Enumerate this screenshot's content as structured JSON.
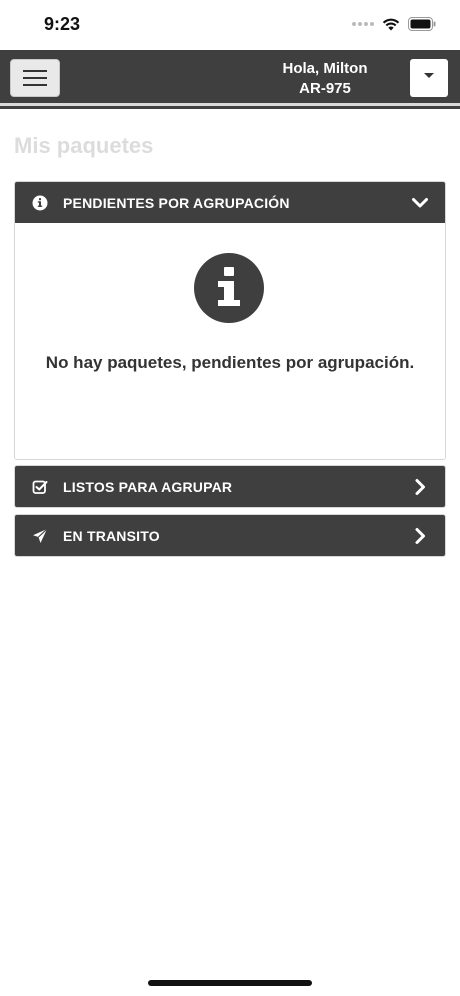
{
  "status_bar": {
    "time": "9:23"
  },
  "navbar": {
    "greeting_line1": "Hola, Milton",
    "greeting_line2": "AR-975",
    "menu_icon": "hamburger-icon",
    "dropdown_icon": "caret-down-icon"
  },
  "page": {
    "title": "Mis paquetes"
  },
  "panels": [
    {
      "label": "PENDIENTES POR AGRUPACIÓN",
      "icon": "info-circle-icon",
      "expanded": true,
      "empty_message": "No hay paquetes, pendientes por agrupación."
    },
    {
      "label": "LISTOS PARA AGRUPAR",
      "icon": "check-square-icon",
      "expanded": false
    },
    {
      "label": "EN TRANSITO",
      "icon": "paper-plane-icon",
      "expanded": false
    }
  ],
  "colors": {
    "header_bg": "#3f3f3f",
    "page_bg": "#ffffff",
    "title_text": "#dcdcdc"
  }
}
